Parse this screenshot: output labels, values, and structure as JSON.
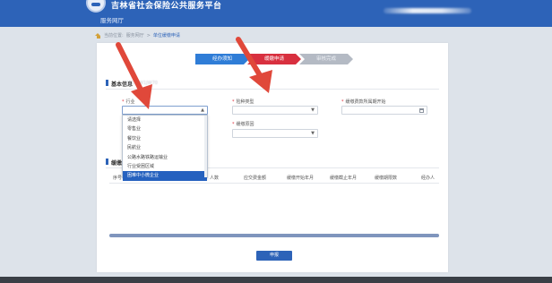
{
  "header": {
    "site_title": "吉林省社会保险公共服务平台",
    "nav_label": "服务网厅",
    "bg_color": "#2d63b8"
  },
  "breadcrumb": {
    "prefix": "当前位置:",
    "parent": "服务网厅",
    "separator": ">",
    "current": "单位缓缴申请"
  },
  "steps": [
    {
      "label": "经办须知",
      "state": "done",
      "color": "#2f7dd7"
    },
    {
      "label": "缓缴申请",
      "state": "active",
      "color": "#d8303f"
    },
    {
      "label": "审核完成",
      "state": "pending",
      "color": "#b4bac4"
    }
  ],
  "sections": {
    "basic_title": "基本信息",
    "basic_id_blurred": "2211LW1JW70",
    "detail_title": "缓缴信息"
  },
  "form": {
    "industry_label": "行业",
    "industry_value": "",
    "insurance_type_label": "险种类型",
    "insurance_type_value": "",
    "start_month_label": "缓缴费款所属期开始",
    "start_month_value": "",
    "reason_label": "缓缴原因",
    "reason_value": ""
  },
  "industry_dropdown": {
    "options": [
      "请选择",
      "零售业",
      "餐饮业",
      "民航业",
      "公路水路铁路运输业",
      "行业受困区域",
      "困难中小微企业"
    ],
    "selected": "困难中小微企业"
  },
  "table": {
    "columns": [
      "序号",
      "人数",
      "应交费金额",
      "缓缴开始年月",
      "缓缴截止年月",
      "缓缴期限数",
      "经办人"
    ]
  },
  "scroll_fraction": 1.0,
  "submit_label": "申报",
  "annotation_color": "#e0483a"
}
